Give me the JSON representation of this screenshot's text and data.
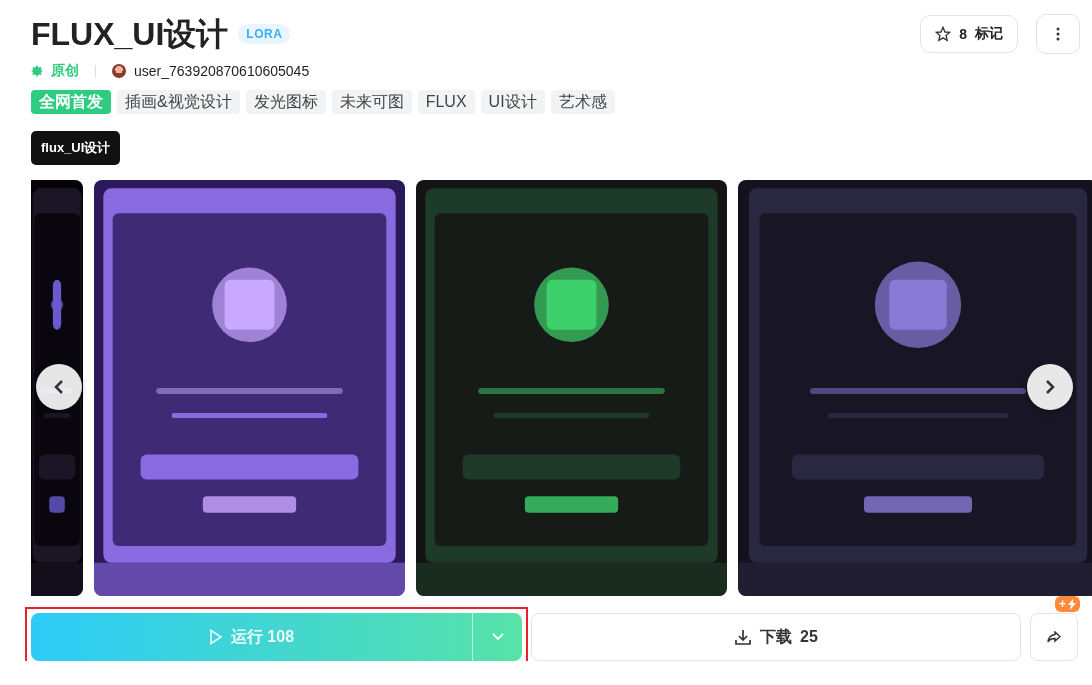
{
  "title": "FLUX_UI设计",
  "type_badge": "LORA",
  "meta": {
    "origin": "原创",
    "author": "user_763920870610605045"
  },
  "bookmark": {
    "count": "8",
    "label": "标记"
  },
  "tags": [
    {
      "label": "全网首发",
      "highlighted": true
    },
    {
      "label": "插画&视觉设计",
      "highlighted": false
    },
    {
      "label": "发光图标",
      "highlighted": false
    },
    {
      "label": "未来可图",
      "highlighted": false
    },
    {
      "label": "FLUX",
      "highlighted": false
    },
    {
      "label": "UI设计",
      "highlighted": false
    },
    {
      "label": "艺术感",
      "highlighted": false
    }
  ],
  "versions": [
    {
      "label": "flux_UI设计",
      "selected": true
    }
  ],
  "actions": {
    "run": {
      "label": "运行",
      "count": "108",
      "highlighted": true
    },
    "download": {
      "label": "下载",
      "count": "25"
    },
    "share_badge": "+"
  }
}
